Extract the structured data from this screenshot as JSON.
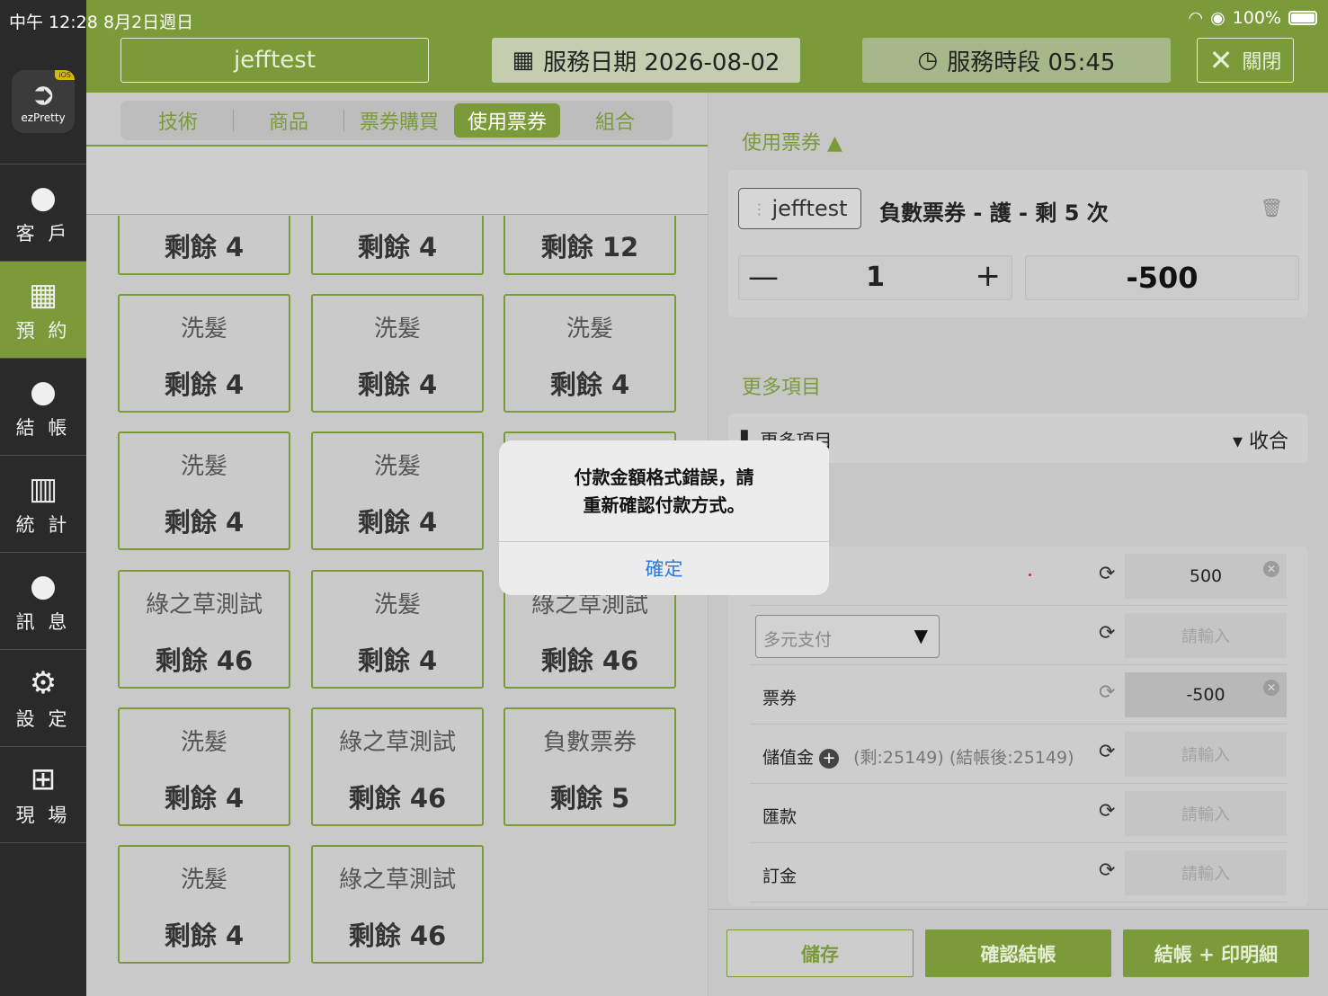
{
  "status_bar": {
    "time": "中午 12:28",
    "date": "8月2日週日",
    "battery": "100%"
  },
  "sidebar": {
    "logo_text": "ezPretty",
    "logo_badge": "iOS",
    "items": [
      {
        "label": "客 戶",
        "icon": "person-circle-icon"
      },
      {
        "label": "預 約",
        "icon": "calendar-icon",
        "active": true
      },
      {
        "label": "結 帳",
        "icon": "person-circle-icon"
      },
      {
        "label": "統 計",
        "icon": "bar-chart-icon"
      },
      {
        "label": "訊 息",
        "icon": "chat-bubble-icon"
      },
      {
        "label": "設 定",
        "icon": "gear-icon"
      },
      {
        "label": "現 場",
        "icon": "grid-icon"
      }
    ]
  },
  "header": {
    "user": "jefftest",
    "service_date": "服務日期 2026-08-02",
    "service_time": "服務時段 05:45",
    "close": "關閉"
  },
  "tabs": [
    "技術",
    "商品",
    "票券購買",
    "使用票券",
    "組合"
  ],
  "active_tab": "使用票券",
  "cards": [
    {
      "name": "",
      "remain": "剩餘 4"
    },
    {
      "name": "",
      "remain": "剩餘 4"
    },
    {
      "name": "",
      "remain": "剩餘 12"
    },
    {
      "name": "洗髮",
      "remain": "剩餘 4"
    },
    {
      "name": "洗髮",
      "remain": "剩餘 4"
    },
    {
      "name": "洗髮",
      "remain": "剩餘 4"
    },
    {
      "name": "洗髮",
      "remain": "剩餘 4"
    },
    {
      "name": "洗髮",
      "remain": "剩餘 4"
    },
    {
      "name": "",
      "remain": ""
    },
    {
      "name": "綠之草測試",
      "remain": "剩餘 46"
    },
    {
      "name": "洗髮",
      "remain": "剩餘 4"
    },
    {
      "name": "綠之草測試",
      "remain": "剩餘 46"
    },
    {
      "name": "洗髮",
      "remain": "剩餘 4"
    },
    {
      "name": "綠之草測試",
      "remain": "剩餘 46"
    },
    {
      "name": "負數票券",
      "remain": "剩餘 5"
    },
    {
      "name": "洗髮",
      "remain": "剩餘 4"
    },
    {
      "name": "綠之草測試",
      "remain": "剩餘 46"
    }
  ],
  "right": {
    "use_ticket_title": "使用票券",
    "ticket": {
      "user": "jefftest",
      "title": "負數票券 - 護 - 剩 5 次",
      "minus": "—",
      "qty": "1",
      "plus": "+",
      "amount": "-500"
    },
    "more_title": "更多項目",
    "more_bar_label": "更多項目",
    "collapse": "▾ 收合",
    "payments": {
      "row1_value": "500",
      "multi_select": "多元支付",
      "ticket_label": "票券",
      "ticket_value": "-500",
      "stored_label": "儲值金",
      "stored_info": "(剩:25149)  (結帳後:25149)",
      "transfer_label": "匯款",
      "deposit_label": "訂金",
      "placeholder": "請輸入"
    },
    "buttons": {
      "save": "儲存",
      "confirm": "確認結帳",
      "print": "結帳 + 印明細"
    }
  },
  "alert": {
    "message_line1": "付款金額格式錯誤，請",
    "message_line2": "重新確認付款方式。",
    "ok": "確定"
  }
}
